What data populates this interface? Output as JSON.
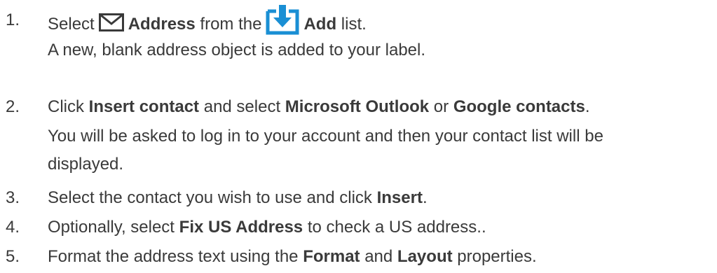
{
  "steps": [
    {
      "num": "1.",
      "pre": "Select",
      "address": "Address",
      "mid": "from the",
      "add": "Add",
      "post": "list.",
      "result": "A new, blank address object is added to your label."
    },
    {
      "num": "2.",
      "pre": "Click",
      "insert_contact": "Insert contact",
      "mid1": "and select",
      "outlook": "Microsoft Outlook",
      "mid2": "or",
      "google": "Google contacts",
      "post": ".",
      "result_line1": "You will be asked to log in to your account and then your contact list will be",
      "result_line2": "displayed."
    },
    {
      "num": "3.",
      "pre": "Select the contact you wish to use and click",
      "insert": "Insert",
      "post": "."
    },
    {
      "num": "4.",
      "pre": "Optionally, select",
      "fix": "Fix US Address",
      "post": "to check a US address.."
    },
    {
      "num": "5.",
      "pre": "Format the address text using the",
      "format": "Format",
      "mid": "and",
      "layout": "Layout",
      "post": "properties."
    }
  ],
  "icons": {
    "envelope": "envelope-icon",
    "add": "add-icon",
    "add_color": "#1a8fd4"
  }
}
